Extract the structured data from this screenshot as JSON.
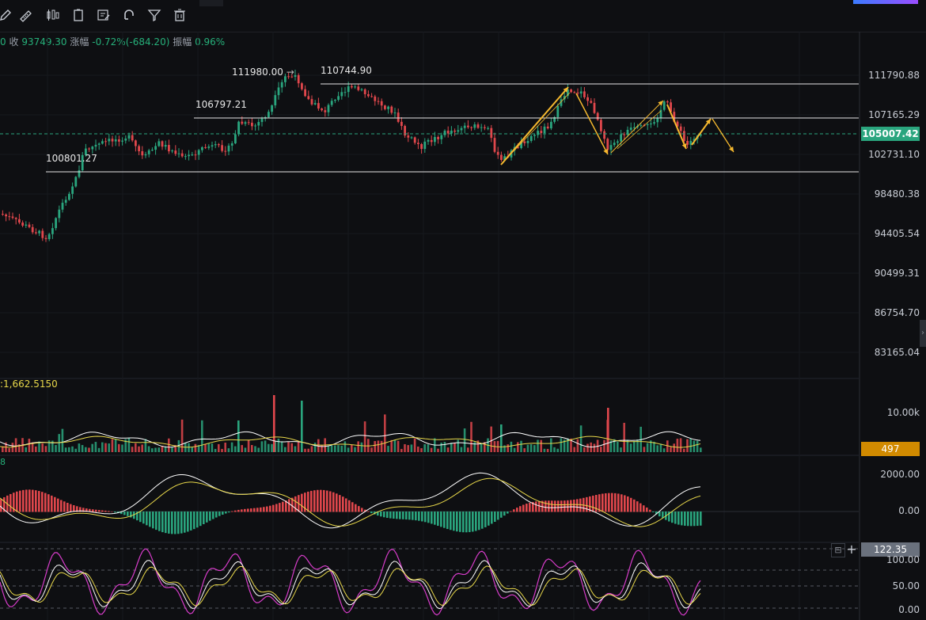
{
  "toolbar": {
    "tools": [
      "pencil-icon",
      "ruler-icon",
      "candles-icon",
      "clipboard-icon",
      "edit-list-icon",
      "magnet-icon",
      "filter-icon",
      "trash-icon"
    ]
  },
  "info": {
    "prefix": "0",
    "close_label": "收",
    "close_value": "93749.30",
    "change_label": "涨幅",
    "change_value": "-0.72%(-684.20)",
    "amplitude_label": "振幅",
    "amplitude_value": "0.96%"
  },
  "price_labels": {
    "high1": "111980.00",
    "high2": "110744.90",
    "mid": "106797.21",
    "low": "100801.27"
  },
  "price_axis": [
    "111790.88",
    "107165.29",
    "102731.10",
    "98480.38",
    "94405.54",
    "90499.31",
    "86754.70",
    "83165.04"
  ],
  "current_price": "105007.42",
  "volume": {
    "label": ":1,662.5150",
    "axis": "10.00k",
    "tag": "497"
  },
  "macd": {
    "label": "8",
    "axis": [
      "2000.00",
      "0.00"
    ]
  },
  "rsi": {
    "tag": "122.35",
    "axis": [
      "100.00",
      "50.00",
      "0.00"
    ],
    "btn_minus": "⊟",
    "btn_plus": "+"
  },
  "colors": {
    "up": "#2aa57e",
    "down": "#e0474c",
    "arrow": "#f5b82e",
    "level": "#e6e6e6"
  }
}
